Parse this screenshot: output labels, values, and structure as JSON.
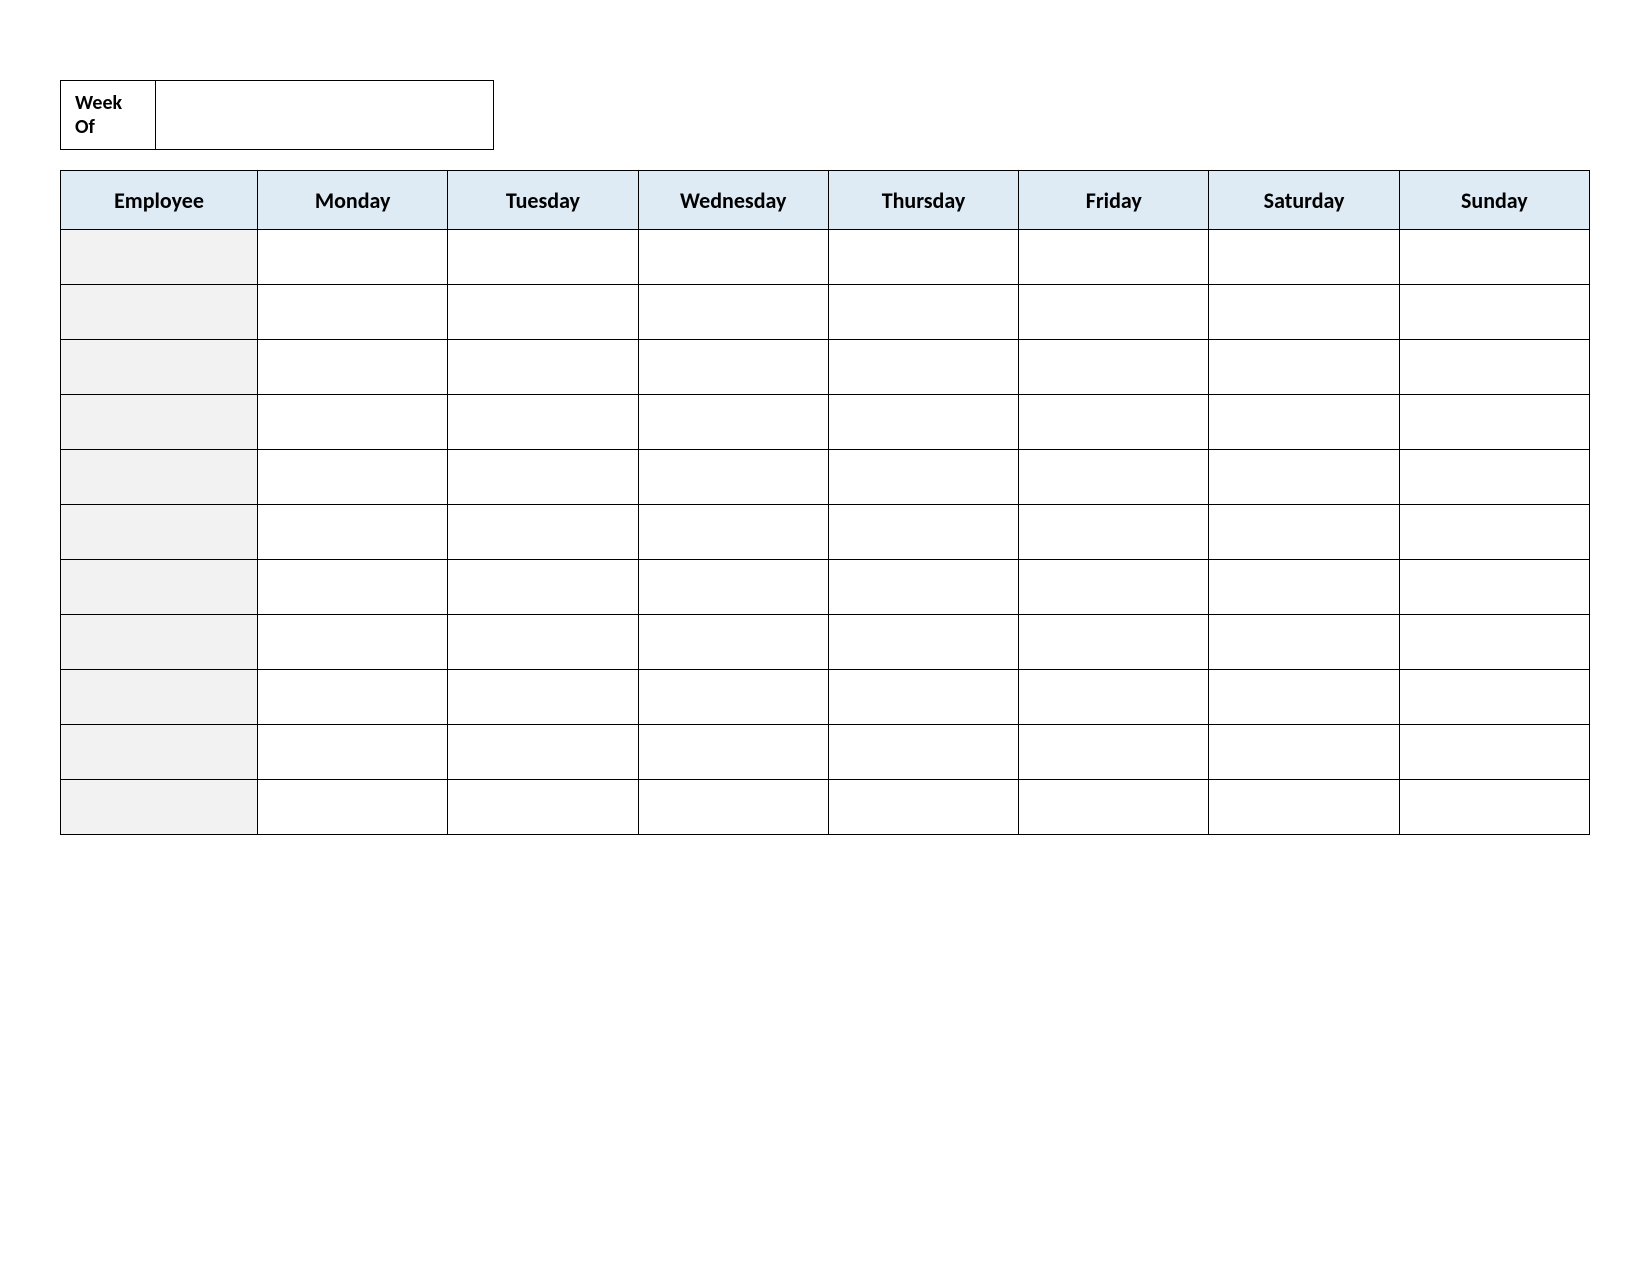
{
  "week_of": {
    "label": "Week Of",
    "value": ""
  },
  "table": {
    "headers": [
      "Employee",
      "Monday",
      "Tuesday",
      "Wednesday",
      "Thursday",
      "Friday",
      "Saturday",
      "Sunday"
    ],
    "rows": [
      {
        "employee": "",
        "cells": [
          "",
          "",
          "",
          "",
          "",
          "",
          ""
        ]
      },
      {
        "employee": "",
        "cells": [
          "",
          "",
          "",
          "",
          "",
          "",
          ""
        ]
      },
      {
        "employee": "",
        "cells": [
          "",
          "",
          "",
          "",
          "",
          "",
          ""
        ]
      },
      {
        "employee": "",
        "cells": [
          "",
          "",
          "",
          "",
          "",
          "",
          ""
        ]
      },
      {
        "employee": "",
        "cells": [
          "",
          "",
          "",
          "",
          "",
          "",
          ""
        ]
      },
      {
        "employee": "",
        "cells": [
          "",
          "",
          "",
          "",
          "",
          "",
          ""
        ]
      },
      {
        "employee": "",
        "cells": [
          "",
          "",
          "",
          "",
          "",
          "",
          ""
        ]
      },
      {
        "employee": "",
        "cells": [
          "",
          "",
          "",
          "",
          "",
          "",
          ""
        ]
      },
      {
        "employee": "",
        "cells": [
          "",
          "",
          "",
          "",
          "",
          "",
          ""
        ]
      },
      {
        "employee": "",
        "cells": [
          "",
          "",
          "",
          "",
          "",
          "",
          ""
        ]
      },
      {
        "employee": "",
        "cells": [
          "",
          "",
          "",
          "",
          "",
          "",
          ""
        ]
      }
    ]
  }
}
